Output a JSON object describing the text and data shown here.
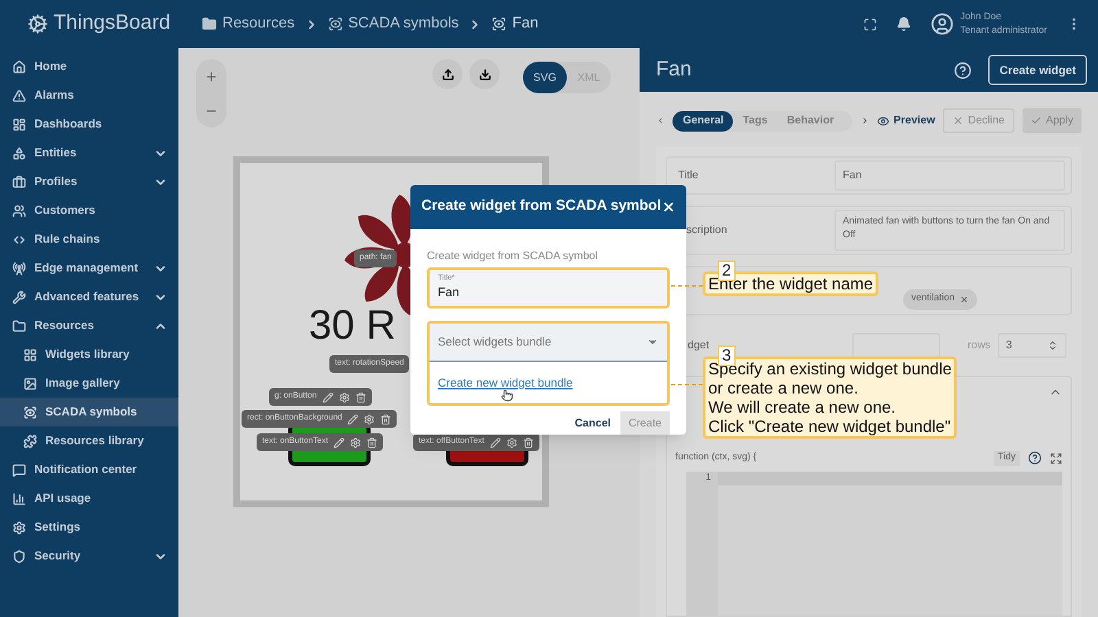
{
  "header": {
    "logo": "ThingsBoard",
    "breadcrumbs": [
      "Resources",
      "SCADA symbols",
      "Fan"
    ],
    "user": {
      "name": "John Doe",
      "role": "Tenant administrator"
    }
  },
  "sidebar": {
    "items": [
      {
        "label": "Home",
        "selected": false
      },
      {
        "label": "Alarms",
        "selected": false
      },
      {
        "label": "Dashboards",
        "selected": false
      },
      {
        "label": "Entities",
        "expanded": false,
        "selected": false
      },
      {
        "label": "Profiles",
        "expanded": false,
        "selected": false
      },
      {
        "label": "Customers",
        "selected": false
      },
      {
        "label": "Rule chains",
        "selected": false
      },
      {
        "label": "Edge management",
        "expanded": false,
        "selected": false
      },
      {
        "label": "Advanced features",
        "expanded": false,
        "selected": false
      },
      {
        "label": "Resources",
        "expanded": true,
        "selected": false,
        "children": [
          {
            "label": "Widgets library",
            "selected": false
          },
          {
            "label": "Image gallery",
            "selected": false
          },
          {
            "label": "SCADA symbols",
            "selected": true
          },
          {
            "label": "Resources library",
            "selected": false
          }
        ]
      },
      {
        "label": "Notification center",
        "selected": false
      },
      {
        "label": "API usage",
        "selected": false
      },
      {
        "label": "Settings",
        "selected": false
      },
      {
        "label": "Security",
        "expanded": false,
        "selected": false
      }
    ]
  },
  "editor": {
    "modes": [
      {
        "label": "SVG",
        "selected": true
      },
      {
        "label": "XML",
        "selected": false
      }
    ],
    "reading": "30 R",
    "element_tags": [
      {
        "label": "path: fan"
      },
      {
        "label": "text: rotationSpeed"
      },
      {
        "label": "g: onButton"
      },
      {
        "label": "rect: onButtonBackground"
      },
      {
        "label": "text: onButtonText"
      },
      {
        "label": "text: offButtonText"
      }
    ]
  },
  "panel": {
    "title": "Fan",
    "create_button": "Create widget",
    "tabs": [
      {
        "label": "General",
        "selected": true
      },
      {
        "label": "Tags",
        "selected": false
      },
      {
        "label": "Behavior",
        "selected": false
      }
    ],
    "preview": "Preview",
    "decline": "Decline",
    "apply": "Apply",
    "fields": {
      "title_label": "Title",
      "title_value": "Fan",
      "description_label": "scription",
      "description_value": "Animated fan with buttons to turn the fan On and Off",
      "tags": [
        "ventilation"
      ],
      "size_label": "dget",
      "rows_label": "rows",
      "rows_value": "3"
    },
    "code": {
      "signature": "function (ctx, svg) {",
      "tidy": "Tidy",
      "line_numbers": [
        "1"
      ]
    }
  },
  "dialog": {
    "title": "Create widget from SCADA symbol",
    "subtitle": "Create widget from SCADA symbol",
    "title_field": {
      "label": "Title*",
      "value": "Fan"
    },
    "bundle_select": {
      "placeholder": "Select widgets bundle"
    },
    "create_bundle_link": "Create new widget bundle",
    "cancel": "Cancel",
    "create": "Create",
    "create_disabled": true
  },
  "callouts": [
    {
      "number": "2",
      "lines": [
        "Enter the widget name"
      ]
    },
    {
      "number": "3",
      "lines": [
        "Specify an existing widget bundle",
        "or create a new one.",
        "We will create a new one.",
        "Click \"Create new widget bundle\""
      ]
    }
  ]
}
